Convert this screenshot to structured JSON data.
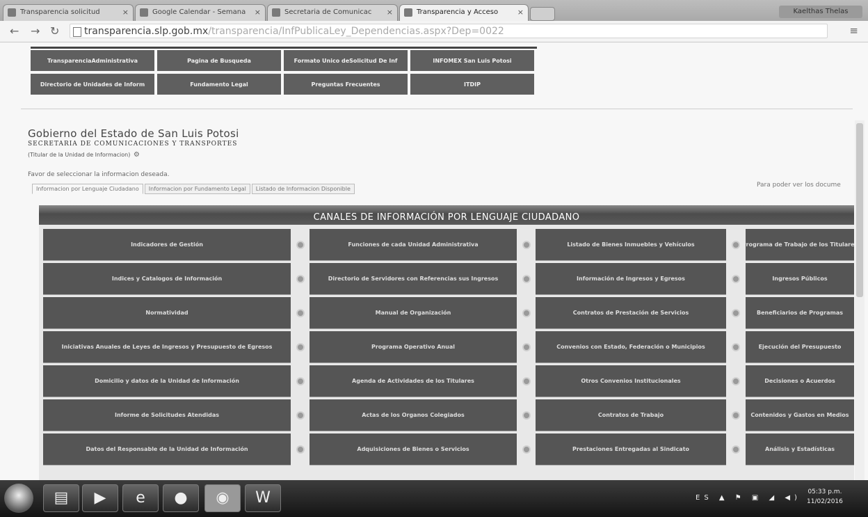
{
  "browser": {
    "tabs": [
      {
        "label": "Transparencia solicitud",
        "active": false
      },
      {
        "label": "Google Calendar - Semana",
        "active": false
      },
      {
        "label": "Secretaria de Comunicac",
        "active": false
      },
      {
        "label": "Transparencia y Acceso",
        "active": true
      }
    ],
    "profile": "Kaelthas Thelas",
    "url_host": "transparencia.slp.gob.mx",
    "url_path": "/transparencia/InfPublicaLey_Dependencias.aspx?Dep=0022",
    "menu_icon": "menu-icon"
  },
  "topnav": [
    "TransparenciaAdministrativa",
    "Pagina de Busqueda",
    "Formato Unico deSolicitud De Inf",
    "INFOMEX San Luis Potosi",
    "Directorio de Unidades de Inform",
    "Fundamento Legal",
    "Preguntas Frecuentes",
    "ITDIP"
  ],
  "header": {
    "title": "Gobierno del Estado de San Luis Potosi",
    "subtitle": "SECRETARIA DE COMUNICACIONES Y TRANSPORTES",
    "unit": "(Titular de la Unidad de Informacion)",
    "select_prompt": "Favor de seleccionar la informacion deseada.",
    "right_note": "Para poder ver los docume"
  },
  "view_tabs": [
    "Informacion por Lenguaje Ciudadano",
    "Informacion por Fundamento Legal",
    "Listado de Informacion Disponible"
  ],
  "section": {
    "title": "CANALES DE INFORMACIÓN POR LENGUAJE CIUDADANO",
    "columns": [
      [
        "Indicadores de Gestión",
        "Indices y Catalogos de Información",
        "Normatividad",
        "Iniciativas Anuales de Leyes de Ingresos y Presupuesto de Egresos",
        "Domicilio y datos de la Unidad de Información",
        "Informe de Solicitudes Atendidas",
        "Datos del Responsable de la Unidad de Información"
      ],
      [
        "Funciones de cada Unidad Administrativa",
        "Directorio de Servidores con Referencias sus Ingresos",
        "Manual de Organización",
        "Programa Operativo Anual",
        "Agenda de Actividades de los Titulares",
        "Actas de los Organos Colegiados",
        "Adquisiciones de Bienes o Servicios"
      ],
      [
        "Listado de Bienes Inmuebles y Vehículos",
        "Información de Ingresos y Egresos",
        "Contratos de Prestación de Servicios",
        "Convenios con Estado, Federación o Municipios",
        "Otros Convenios Institucionales",
        "Contratos de Trabajo",
        "Prestaciones Entregadas al Sindicato"
      ],
      [
        "Programa de Trabajo de los Titulares",
        "Ingresos Públicos",
        "Beneficiarios de Programas",
        "Ejecución del Presupuesto",
        "Decisiones o Acuerdos",
        "Contenidos y Gastos en Medios",
        "Análisis y Estadísticas"
      ]
    ]
  },
  "taskbar": {
    "lang": "ES",
    "time": "05:33 p.m.",
    "date": "11/02/2016"
  }
}
